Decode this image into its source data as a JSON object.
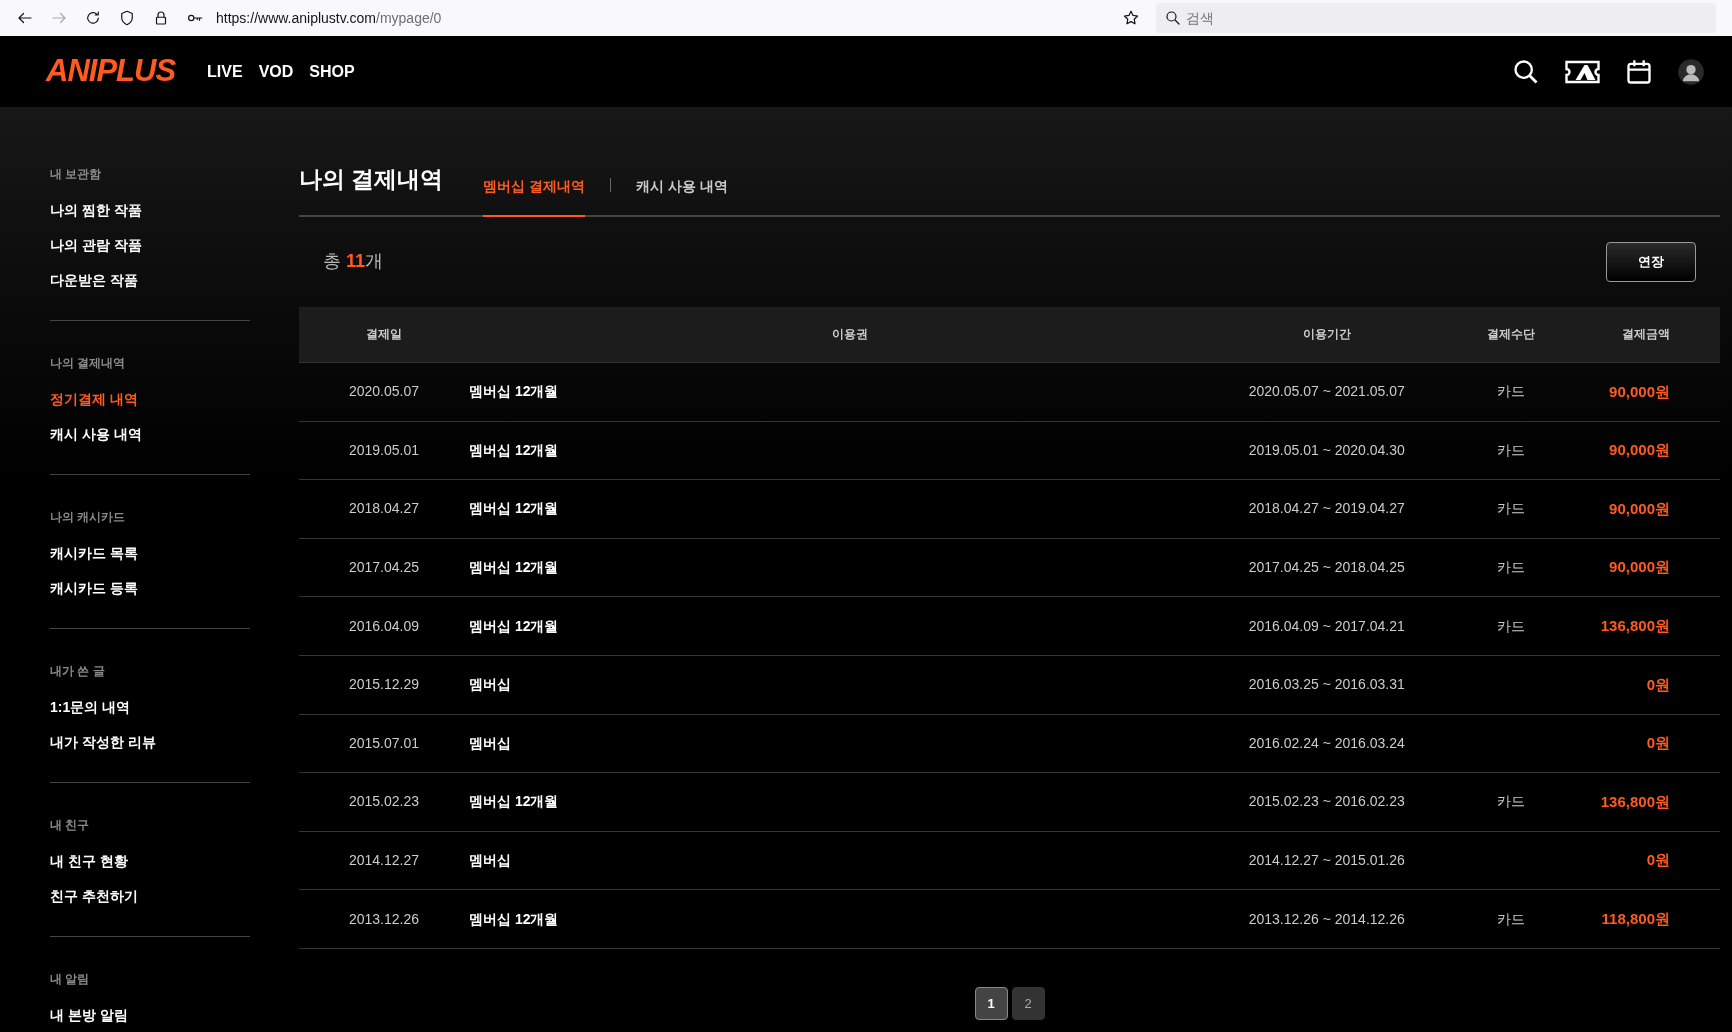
{
  "browser": {
    "url_host": "https://www.aniplustv.com",
    "url_path": "/mypage/0",
    "search_placeholder": "검색"
  },
  "header": {
    "logo": "ANIPLUS",
    "nav": [
      "LIVE",
      "VOD",
      "SHOP"
    ]
  },
  "sidebar": [
    {
      "title": "내 보관함",
      "items": [
        {
          "label": "나의 찜한 작품",
          "selected": false
        },
        {
          "label": "나의 관람 작품",
          "selected": false
        },
        {
          "label": "다운받은 작품",
          "selected": false
        }
      ]
    },
    {
      "title": "나의 결제내역",
      "items": [
        {
          "label": "정기결제 내역",
          "selected": true
        },
        {
          "label": "캐시 사용 내역",
          "selected": false
        }
      ]
    },
    {
      "title": "나의 캐시카드",
      "items": [
        {
          "label": "캐시카드 목록",
          "selected": false
        },
        {
          "label": "캐시카드 등록",
          "selected": false
        }
      ]
    },
    {
      "title": "내가 쓴 글",
      "items": [
        {
          "label": "1:1문의 내역",
          "selected": false
        },
        {
          "label": "내가 작성한 리뷰",
          "selected": false
        }
      ]
    },
    {
      "title": "내 친구",
      "items": [
        {
          "label": "내 친구 현황",
          "selected": false
        },
        {
          "label": "친구 추천하기",
          "selected": false
        }
      ]
    },
    {
      "title": "내 알림",
      "items": [
        {
          "label": "내 본방 알림",
          "selected": false
        }
      ]
    }
  ],
  "page_title": "나의 결제내역",
  "tabs": [
    {
      "label": "멤버십 결제내역",
      "selected": true
    },
    {
      "label": "캐시 사용 내역",
      "selected": false
    }
  ],
  "total": {
    "prefix": "총",
    "count": "11",
    "suffix": "개"
  },
  "extend_button": "연장",
  "table": {
    "columns": [
      "결제일",
      "이용권",
      "이용기간",
      "결제수단",
      "결제금액"
    ],
    "rows": [
      {
        "date": "2020.05.07",
        "plan": "멤버십 12개월",
        "period": "2020.05.07 ~ 2021.05.07",
        "method": "카드",
        "amount": "90,000원"
      },
      {
        "date": "2019.05.01",
        "plan": "멤버십 12개월",
        "period": "2019.05.01 ~ 2020.04.30",
        "method": "카드",
        "amount": "90,000원"
      },
      {
        "date": "2018.04.27",
        "plan": "멤버십 12개월",
        "period": "2018.04.27 ~ 2019.04.27",
        "method": "카드",
        "amount": "90,000원"
      },
      {
        "date": "2017.04.25",
        "plan": "멤버십 12개월",
        "period": "2017.04.25 ~ 2018.04.25",
        "method": "카드",
        "amount": "90,000원"
      },
      {
        "date": "2016.04.09",
        "plan": "멤버십 12개월",
        "period": "2016.04.09 ~ 2017.04.21",
        "method": "카드",
        "amount": "136,800원"
      },
      {
        "date": "2015.12.29",
        "plan": "멤버십",
        "period": "2016.03.25 ~ 2016.03.31",
        "amount": "0원"
      },
      {
        "date": "2015.07.01",
        "plan": "멤버십",
        "period": "2016.02.24 ~ 2016.03.24",
        "amount": "0원"
      },
      {
        "date": "2015.02.23",
        "plan": "멤버십 12개월",
        "period": "2015.02.23 ~ 2016.02.23",
        "method": "카드",
        "amount": "136,800원"
      },
      {
        "date": "2014.12.27",
        "plan": "멤버십",
        "period": "2014.12.27 ~ 2015.01.26",
        "amount": "0원"
      },
      {
        "date": "2013.12.26",
        "plan": "멤버십 12개월",
        "period": "2013.12.26 ~ 2014.12.26",
        "method": "카드",
        "amount": "118,800원"
      }
    ]
  },
  "pagination": [
    {
      "label": "1",
      "selected": true
    },
    {
      "label": "2",
      "selected": false
    }
  ]
}
